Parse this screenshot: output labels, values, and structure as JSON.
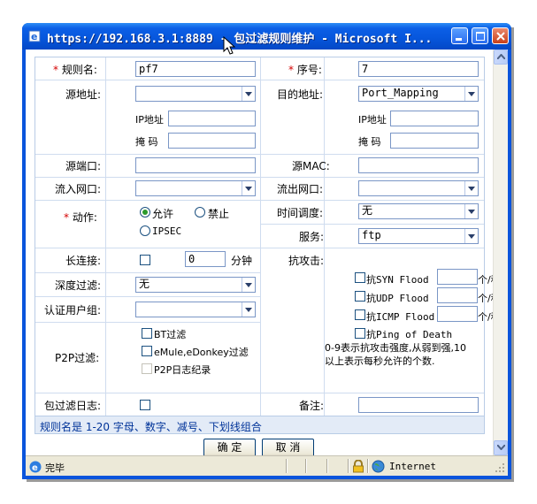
{
  "window": {
    "title": "https://192.168.3.1:8889 - 包过滤规则维护 - Microsoft I...",
    "status_text": "完毕",
    "zone": "Internet"
  },
  "form": {
    "rule_name_label": "规则名:",
    "rule_name_value": "pf7",
    "seq_label": "序号:",
    "seq_value": "7",
    "src_addr_label": "源地址:",
    "src_addr_value": "",
    "dst_addr_label": "目的地址:",
    "dst_addr_value": "Port_Mapping",
    "ip_label": "IP地址",
    "mask_label": "掩  码",
    "src_port_label": "源端口:",
    "src_mac_label": "源MAC:",
    "in_if_label": "流入网口:",
    "out_if_label": "流出网口:",
    "action_label": "动作:",
    "action_options": [
      "允许",
      "禁止",
      "IPSEC"
    ],
    "time_label": "时间调度:",
    "time_value": "无",
    "service_label": "服务:",
    "service_value": "ftp",
    "keepalive_label": "长连接:",
    "keepalive_minutes": "0",
    "minutes_unit": "分钟",
    "attack_label": "抗攻击:",
    "attacks": [
      {
        "name": "抗SYN  Flood",
        "unit": "个/秒"
      },
      {
        "name": "抗UDP  Flood",
        "unit": "个/秒"
      },
      {
        "name": "抗ICMP Flood",
        "unit": "个/秒"
      },
      {
        "name": "抗Ping of Death",
        "unit": ""
      }
    ],
    "attack_note_1": "0-9表示抗攻击强度,从弱到强,10",
    "attack_note_2": "以上表示每秒允许的个数.",
    "deep_filter_label": "深度过滤:",
    "deep_filter_value": "无",
    "auth_group_label": "认证用户组:",
    "p2p_label": "P2P过滤:",
    "p2p_options": [
      "BT过滤",
      "eMule,eDonkey过滤",
      "P2P日志纪录"
    ],
    "log_label": "包过滤日志:",
    "remark_label": "备注:",
    "hint": "规则名是 1-20 字母、数字、减号、下划线组合"
  },
  "buttons": {
    "ok": "确  定",
    "cancel": "取  消"
  },
  "colors": {
    "title_bar": "#0757dd",
    "required": "#d40000",
    "hint": "#003399"
  }
}
